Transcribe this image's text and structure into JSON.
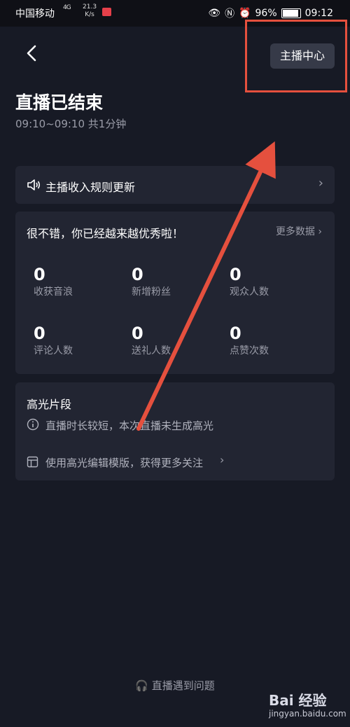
{
  "status_bar": {
    "carrier": "中国移动",
    "network": "4G",
    "speed_value": "21.3",
    "speed_unit": "K/s",
    "battery": "96%",
    "time": "09:12"
  },
  "header": {
    "back_icon": "chevron-left-icon",
    "host_center_label": "主播中心"
  },
  "summary": {
    "title": "直播已结束",
    "subtitle": "09:10~09:10 共1分钟"
  },
  "notice": {
    "icon": "speaker-icon",
    "text": "主播收入规则更新"
  },
  "stats": {
    "heading": "很不错，你已经越来越优秀啦！",
    "more_label": "更多数据",
    "items": [
      {
        "value": "0",
        "label": "收获音浪"
      },
      {
        "value": "0",
        "label": "新增粉丝"
      },
      {
        "value": "0",
        "label": "观众人数"
      },
      {
        "value": "0",
        "label": "评论人数"
      },
      {
        "value": "0",
        "label": "送礼人数"
      },
      {
        "value": "0",
        "label": "点赞次数"
      }
    ]
  },
  "highlights": {
    "title": "高光片段",
    "info": "直播时长较短，本次直播未生成高光",
    "template_link": "使用高光编辑模版，获得更多关注"
  },
  "footer": {
    "problem_label": "直播遇到问题"
  },
  "watermark": {
    "logo": "Bai 经验",
    "url": "jingyan.baidu.com"
  },
  "colors": {
    "background": "#171a25",
    "card": "#222532",
    "annotation_red": "#e5503e"
  }
}
